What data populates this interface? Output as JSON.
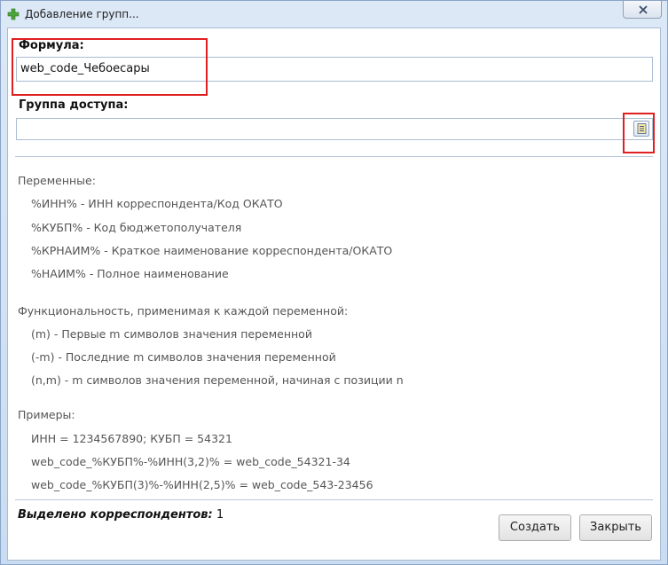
{
  "window": {
    "title": "Добавление групп...",
    "close_icon": "close-icon",
    "app_icon": "green-plus-icon"
  },
  "form": {
    "formula_label": "Формула:",
    "formula_value": "web_code_Чебоесары",
    "access_group_label": "Группа доступа:",
    "access_group_value": "",
    "lookup_icon": "dictionary-lookup-icon"
  },
  "help": {
    "variables_heading": "Переменные:",
    "variables": [
      "%ИНН% - ИНН корреспондента/Код ОКАТО",
      "%КУБП% - Код бюджетополучателя",
      "%КРНАИМ% - Краткое наименование корреспондента/ОКАТО",
      "%НАИМ% - Полное наименование"
    ],
    "functions_heading": "Функциональность, применимая к каждой переменной:",
    "functions": [
      "(m) - Первые m символов значения переменной",
      "(-m) - Последние m символов значения переменной",
      "(n,m) - m символов значения переменной, начиная с позиции n"
    ],
    "examples_heading": "Примеры:",
    "examples": [
      "ИНН = 1234567890;  КУБП = 54321",
      "web_code_%КУБП%-%ИНН(3,2)%  =  web_code_54321-34",
      "web_code_%КУБП(3)%-%ИНН(2,5)%  =  web_code_543-23456"
    ]
  },
  "footer": {
    "selected_label": "Выделено корреспондентов:",
    "selected_count": "1",
    "create_label": "Создать",
    "close_label": "Закрыть"
  },
  "colors": {
    "highlight_border": "#e02020",
    "title_bar": "#dce8f6"
  }
}
